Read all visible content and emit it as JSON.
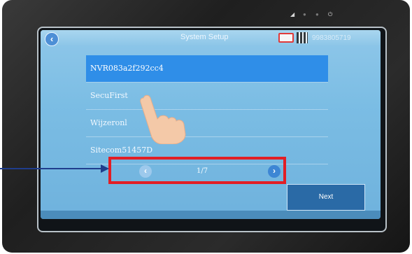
{
  "header": {
    "back_icon": "chevron-left-icon",
    "title": "System Setup",
    "device_id": "9983805719"
  },
  "wifi_list": {
    "items": [
      {
        "ssid": "NVR083a2f292cc4",
        "selected": true
      },
      {
        "ssid": "SecuFirst",
        "selected": false
      },
      {
        "ssid": "Wijzeronl",
        "selected": false
      },
      {
        "ssid": "Sitecom51457D",
        "selected": false
      }
    ]
  },
  "pager": {
    "prev_icon": "chevron-left-icon",
    "next_icon": "chevron-right-icon",
    "label": "1/7"
  },
  "next_button": {
    "label": "Next"
  },
  "colors": {
    "selected_row": "#2f8ee8",
    "highlight_border": "#e21e25",
    "arrow": "#1f3d8c"
  }
}
